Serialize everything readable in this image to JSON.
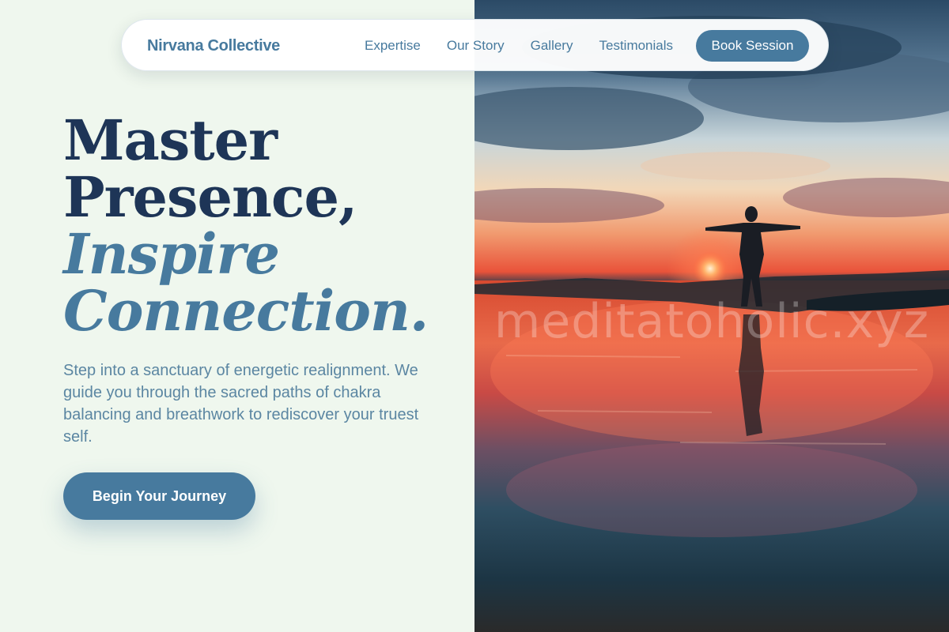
{
  "nav": {
    "brand": "Nirvana Collective",
    "links": [
      "Expertise",
      "Our Story",
      "Gallery",
      "Testimonials"
    ],
    "cta": "Book Session"
  },
  "hero": {
    "title_line1": "Master",
    "title_line2": "Presence,",
    "title_line3": "Inspire",
    "title_line4": "Connection.",
    "description": "Step into a sanctuary of energetic realignment. We guide you through the sacred paths of chakra balancing and breathwork to rediscover your truest self.",
    "cta": "Begin Your Journey"
  },
  "image": {
    "watermark": "meditatoholic.xyz",
    "alt": "Silhouette of a person with outstretched arms at sunset on a reflective beach"
  },
  "colors": {
    "background": "#eff7ee",
    "primary": "#477a9e",
    "heading": "#1e3557",
    "body_text": "#5b86a2"
  }
}
